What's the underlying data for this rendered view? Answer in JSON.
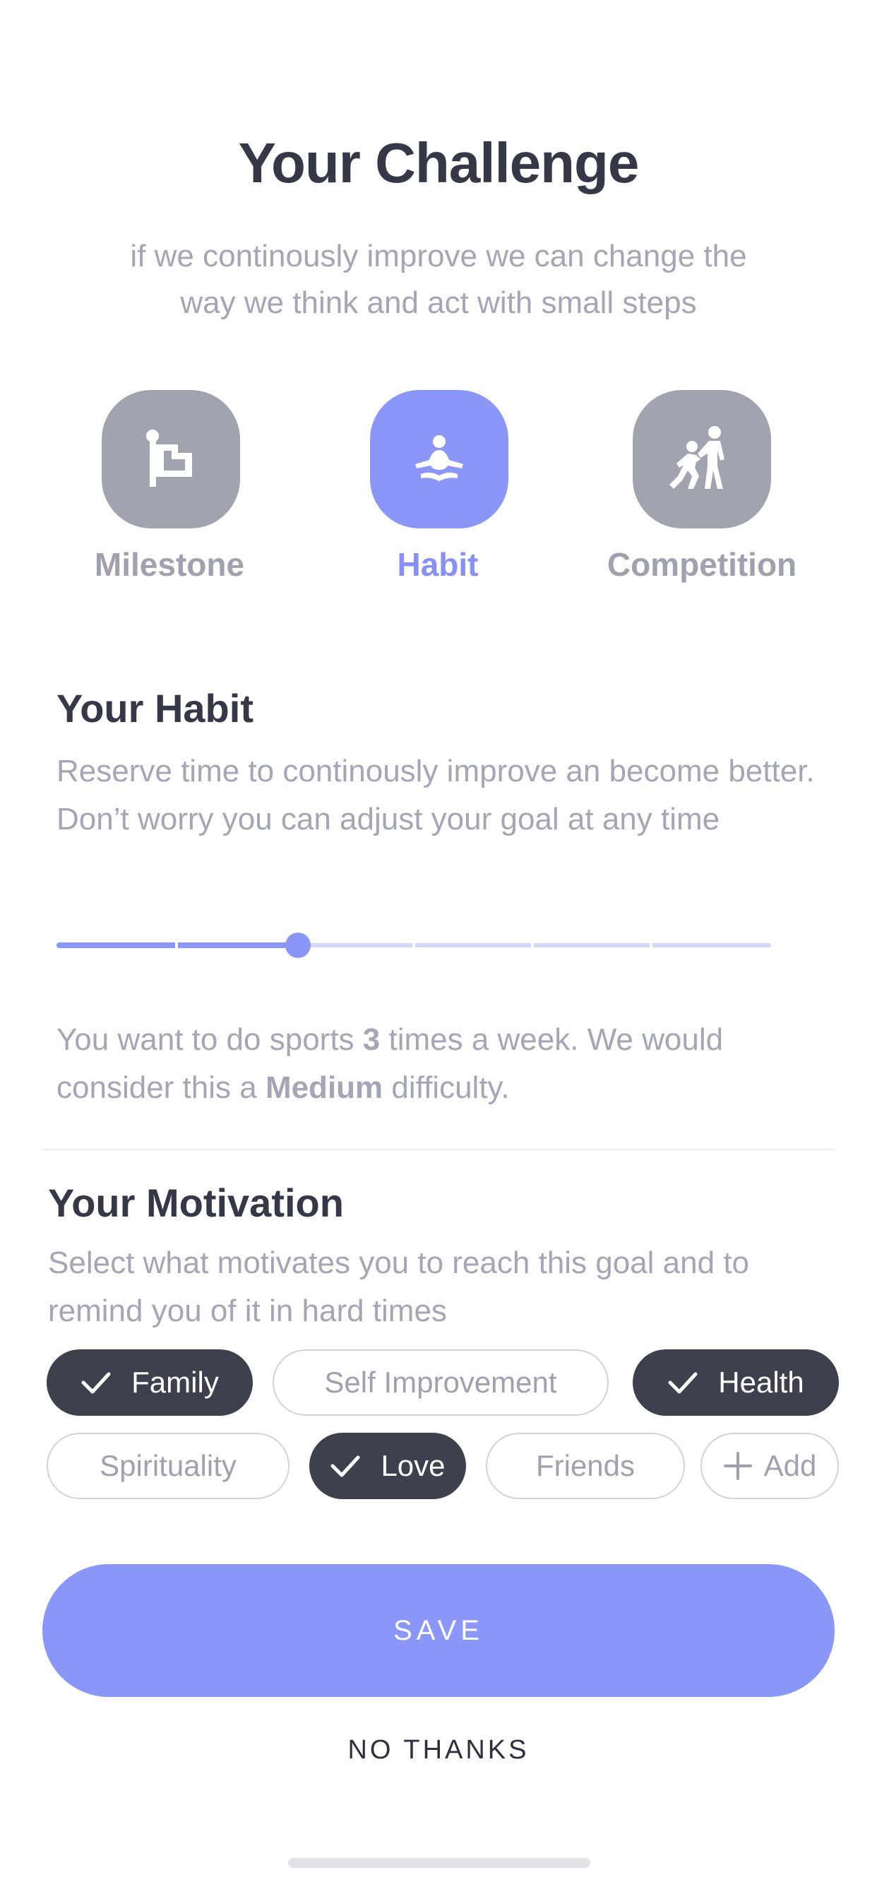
{
  "header": {
    "title": "Your Challenge",
    "subtitle": "if we continously improve we can change the way we think and act with small steps"
  },
  "challenge_types": [
    {
      "label": "Milestone",
      "icon": "flag-icon",
      "selected": false
    },
    {
      "label": "Habit",
      "icon": "meditation-icon",
      "selected": true
    },
    {
      "label": "Competition",
      "icon": "helping-people-icon",
      "selected": false
    }
  ],
  "habit": {
    "heading": "Your Habit",
    "description": "Reserve time to continously improve an become better. Don’t worry you can adjust your goal at any time",
    "slider": {
      "value": 3,
      "steps": 7
    },
    "summary": {
      "prefix": "You want to do sports ",
      "count": "3",
      "middle": " times a week. We would consider this a ",
      "difficulty": "Medium",
      "suffix": " difficulty."
    }
  },
  "motivation": {
    "heading": "Your Motivation",
    "description": "Select what motivates you to reach this goal and to remind you of it in hard times",
    "tags": [
      {
        "label": "Family",
        "selected": true
      },
      {
        "label": "Self Improvement",
        "selected": false
      },
      {
        "label": "Health",
        "selected": true
      },
      {
        "label": "Spirituality",
        "selected": false
      },
      {
        "label": "Love",
        "selected": true
      },
      {
        "label": "Friends",
        "selected": false
      }
    ],
    "add_label": "Add"
  },
  "actions": {
    "save_label": "SAVE",
    "decline_label": "NO THANKS"
  },
  "colors": {
    "accent": "#8b96f9",
    "selected_chip": "#3e404d",
    "inactive_icon_bg": "#a1a3ae"
  }
}
